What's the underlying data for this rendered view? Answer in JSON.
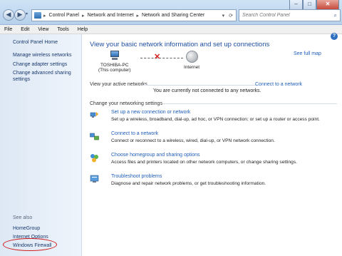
{
  "window": {
    "minimize_glyph": "–",
    "maximize_glyph": "□",
    "close_glyph": "✕"
  },
  "navigation": {
    "back_glyph": "◀",
    "forward_glyph": "▶",
    "dropdown_glyph": "▾",
    "breadcrumbs": [
      "Control Panel",
      "Network and Internet",
      "Network and Sharing Center"
    ],
    "separator": "▸",
    "address_dropdown_glyph": "▾",
    "refresh_glyph": "⟳",
    "search_placeholder": "Search Control Panel",
    "search_glyph": "⌕"
  },
  "menubar": {
    "items": [
      "File",
      "Edit",
      "View",
      "Tools",
      "Help"
    ]
  },
  "help_glyph": "?",
  "sidebar": {
    "home": "Control Panel Home",
    "links": [
      "Manage wireless networks",
      "Change adapter settings",
      "Change advanced sharing settings"
    ],
    "see_also_label": "See also",
    "see_also": [
      "HomeGroup",
      "Internet Options",
      "Windows Firewall"
    ],
    "highlighted_item": "Windows Firewall",
    "highlight_color": "#d02020"
  },
  "main": {
    "heading": "View your basic network information and set up connections",
    "full_map_link": "See full map",
    "computer_name": "TOSHIBA-PC",
    "computer_subtitle": "(This computer)",
    "internet_label": "Internet",
    "disconnected_glyph": "✕",
    "active_networks_label": "View your active networks",
    "connect_link": "Connect to a network",
    "not_connected_text": "You are currently not connected to any networks.",
    "settings_label": "Change your networking settings",
    "tasks": [
      {
        "title": "Set up a new connection or network",
        "description": "Set up a wireless, broadband, dial-up, ad hoc, or VPN connection; or set up a router or access point."
      },
      {
        "title": "Connect to a network",
        "description": "Connect or reconnect to a wireless, wired, dial-up, or VPN network connection."
      },
      {
        "title": "Choose homegroup and sharing options",
        "description": "Access files and printers located on other network computers, or change sharing settings."
      },
      {
        "title": "Troubleshoot problems",
        "description": "Diagnose and repair network problems, or get troubleshooting information."
      }
    ]
  }
}
